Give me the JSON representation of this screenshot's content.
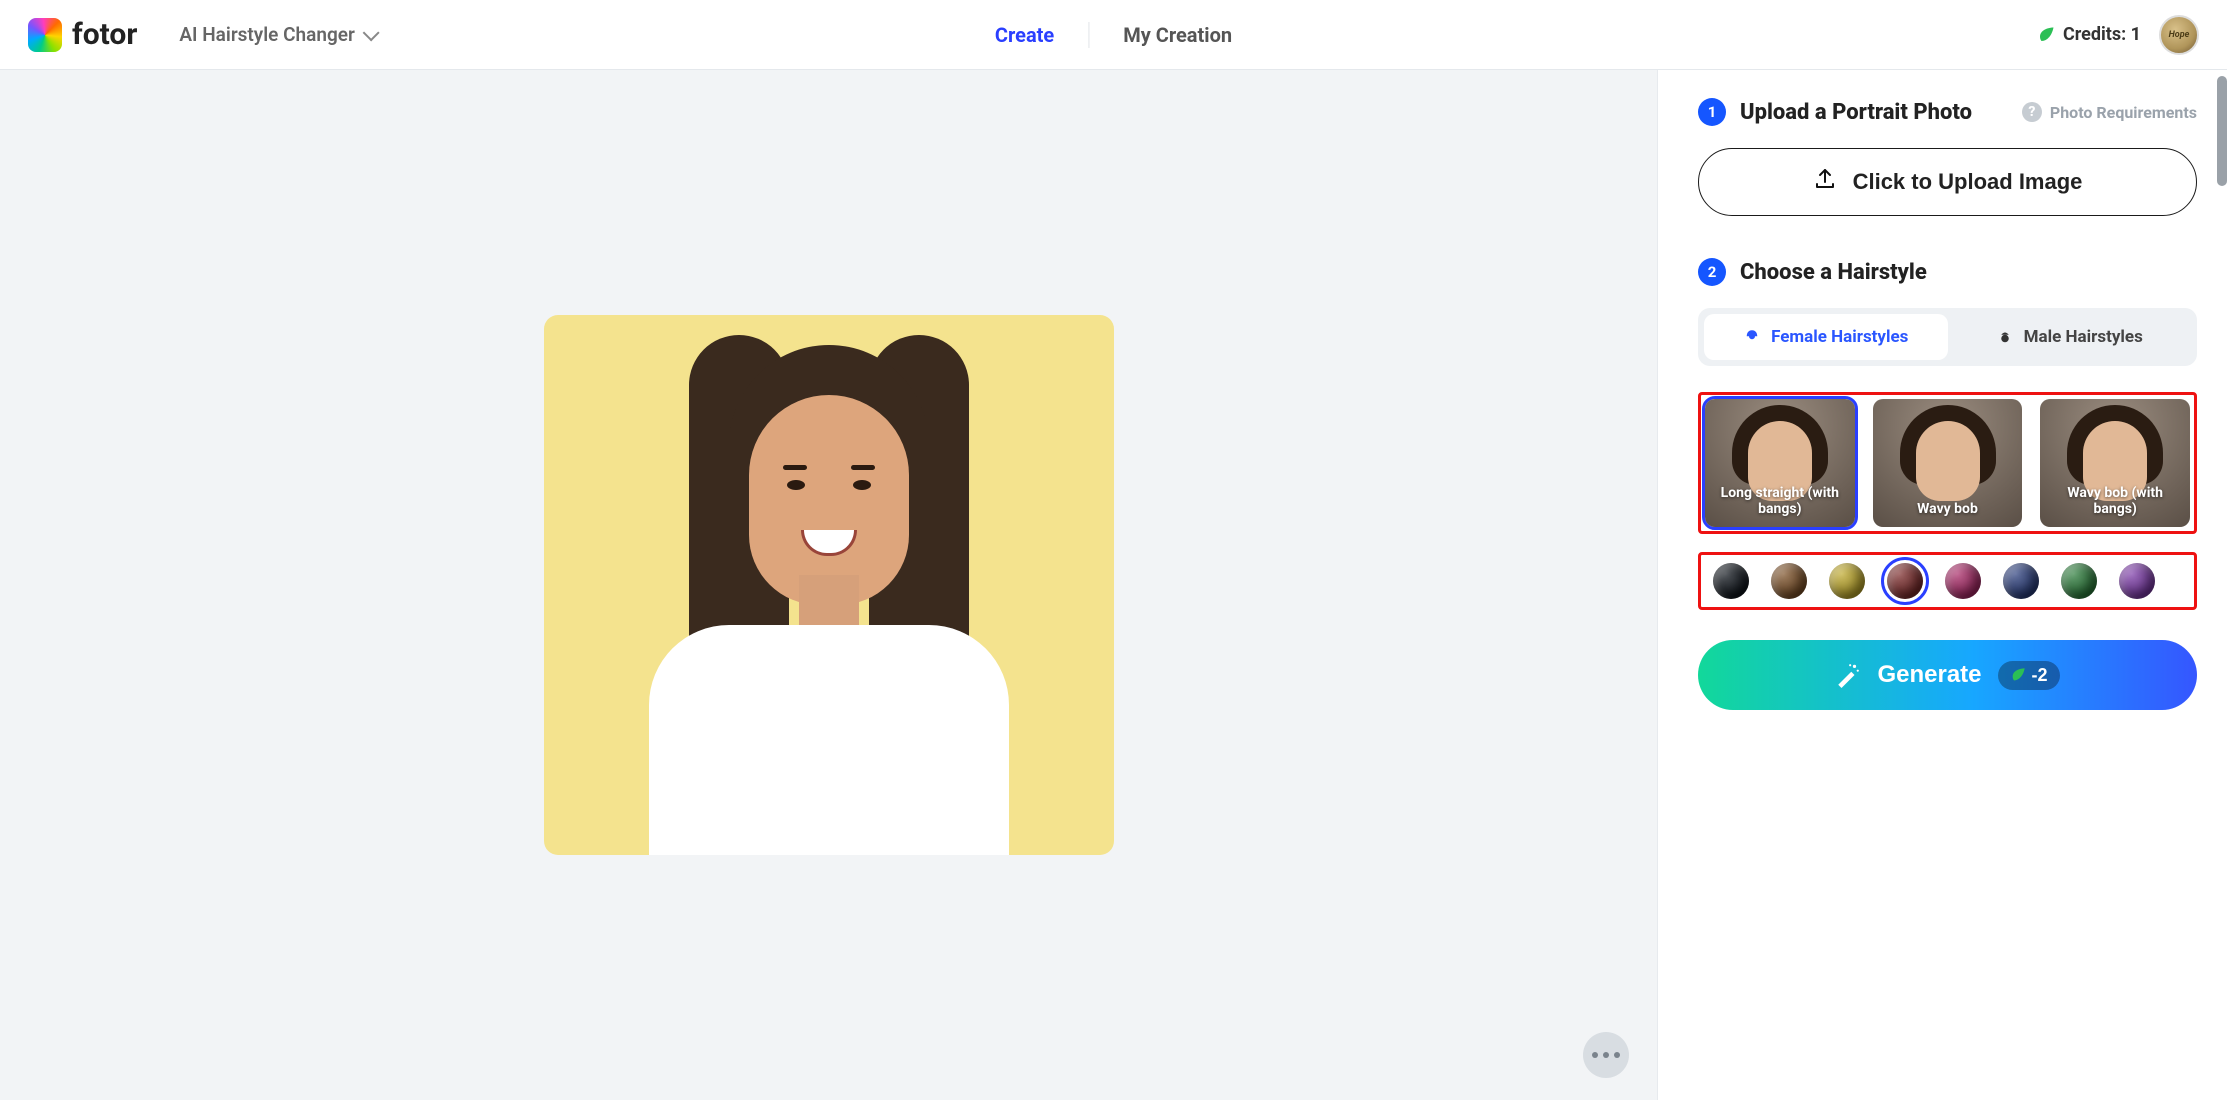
{
  "header": {
    "brand": "fotor",
    "tool_selector_label": "AI Hairstyle Changer",
    "nav_create_label": "Create",
    "nav_mycreation_label": "My Creation",
    "credits_label": "Credits: 1",
    "avatar_text": "Hope"
  },
  "panel": {
    "step1": {
      "number": "1",
      "title": "Upload a Portrait Photo"
    },
    "photo_requirements_label": "Photo Requirements",
    "help_icon_char": "?",
    "upload_button_label": "Click to Upload Image",
    "step2": {
      "number": "2",
      "title": "Choose a Hairstyle"
    },
    "gender_tabs": {
      "female_label": "Female Hairstyles",
      "male_label": "Male Hairstyles",
      "active": "female"
    },
    "hairstyle_options": [
      {
        "label": "Long straight (with bangs)",
        "selected": true
      },
      {
        "label": "Wavy bob",
        "selected": false
      },
      {
        "label": "Wavy bob (with bangs)",
        "selected": false
      }
    ],
    "color_swatches": [
      {
        "name": "black",
        "hex": "#0b0f14",
        "selected": false
      },
      {
        "name": "brown",
        "hex": "#5a3a1c",
        "selected": false
      },
      {
        "name": "olive",
        "hex": "#8a7a1e",
        "selected": false
      },
      {
        "name": "auburn",
        "hex": "#5a1f1f",
        "selected": true
      },
      {
        "name": "magenta",
        "hex": "#7a1d4a",
        "selected": false
      },
      {
        "name": "navy",
        "hex": "#1e2c5a",
        "selected": false
      },
      {
        "name": "green",
        "hex": "#1f5a2a",
        "selected": false
      },
      {
        "name": "violet",
        "hex": "#5a2a7a",
        "selected": false
      }
    ],
    "generate_label": "Generate",
    "generate_cost": "-2"
  }
}
